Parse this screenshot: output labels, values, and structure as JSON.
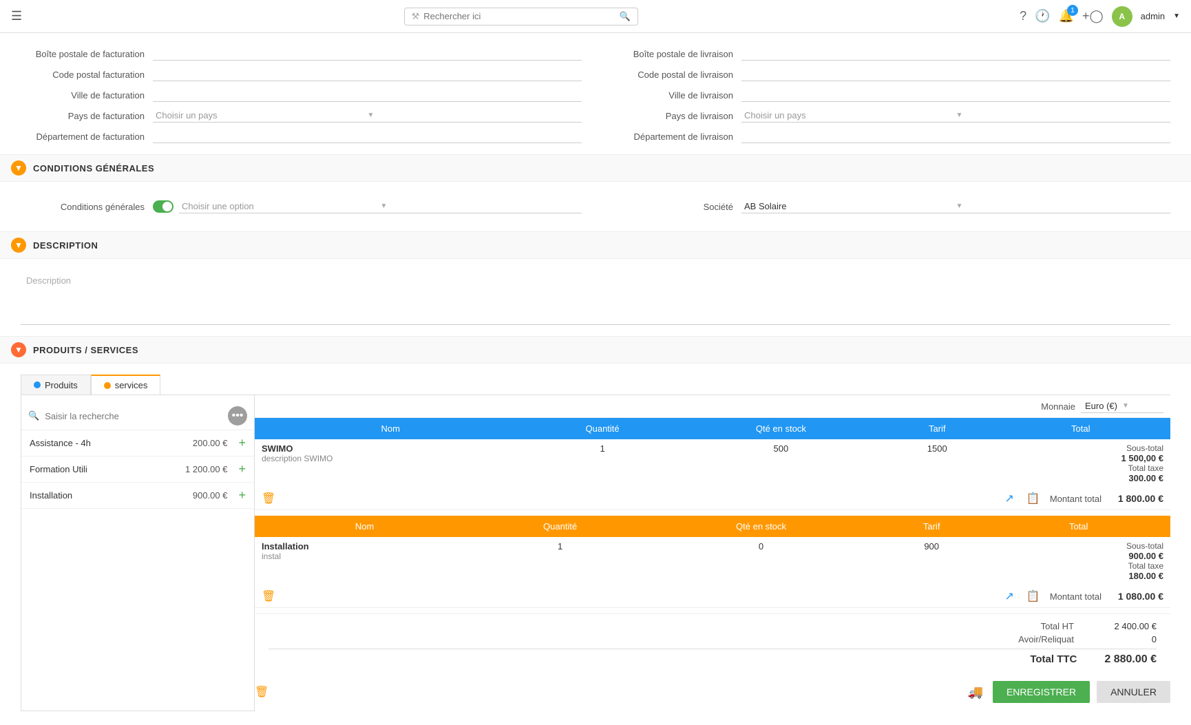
{
  "topbar": {
    "search_placeholder": "Rechercher ici",
    "notification_count": "1",
    "user_label": "admin",
    "user_initial": "A"
  },
  "form": {
    "billing": {
      "boite_postale_label": "Boîte postale de facturation",
      "code_postal_label": "Code postal facturation",
      "ville_label": "Ville de facturation",
      "pays_label": "Pays de facturation",
      "pays_placeholder": "Choisir un pays",
      "departement_label": "Département de facturation"
    },
    "delivery": {
      "boite_postale_label": "Boîte postale de livraison",
      "code_postal_label": "Code postal de livraison",
      "ville_label": "Ville de livraison",
      "pays_label": "Pays de livraison",
      "pays_placeholder": "Choisir un pays",
      "departement_label": "Département de livraison"
    }
  },
  "conditions_section": {
    "title": "CONDITIONS GÉNÉRALES",
    "conditions_generales_label": "Conditions générales",
    "conditions_placeholder": "Choisir une option",
    "societe_label": "Société",
    "societe_value": "AB Solaire"
  },
  "description_section": {
    "title": "DESCRIPTION",
    "placeholder": "Description"
  },
  "produits_section": {
    "title": "PRODUITS / SERVICES",
    "tabs": [
      {
        "label": "Produits",
        "color": "#2196f3",
        "active": false
      },
      {
        "label": "Services",
        "color": "#ff9800",
        "active": true
      }
    ],
    "currency_label": "Monnaie",
    "currency_value": "Euro (€)",
    "search_placeholder": "Saisir la recherche",
    "sidebar_items": [
      {
        "name": "Assistance - 4h",
        "price": "200.00 €"
      },
      {
        "name": "Formation Utili",
        "price": "1 200.00 €"
      },
      {
        "name": "Installation",
        "price": "900.00 €"
      }
    ],
    "table_headers": [
      "Nom",
      "Quantité",
      "Qté en stock",
      "Tarif",
      "Total"
    ],
    "blue_table": {
      "product_name": "SWIMO",
      "description": "description SWIMO",
      "quantite": "1",
      "qte_stock": "500",
      "tarif": "1500",
      "sous_total_label": "Sous-total",
      "sous_total_value": "1 500,00 €",
      "total_taxe_label": "Total taxe",
      "total_taxe_value": "300.00 €",
      "montant_total_label": "Montant total",
      "montant_total_value": "1 800.00 €"
    },
    "orange_table": {
      "product_name": "Installation",
      "description": "instal",
      "quantite": "1",
      "qte_stock": "0",
      "tarif": "900",
      "sous_total_label": "Sous-total",
      "sous_total_value": "900.00 €",
      "total_taxe_label": "Total taxe",
      "total_taxe_value": "180.00 €",
      "montant_total_label": "Montant total",
      "montant_total_value": "1 080.00 €"
    },
    "total_ht_label": "Total HT",
    "total_ht_value": "2 400.00 €",
    "avoir_label": "Avoir/Reliquat",
    "avoir_value": "0",
    "total_ttc_label": "Total TTC",
    "total_ttc_value": "2 880.00 €",
    "btn_enregistrer": "ENREGISTRER",
    "btn_annuler": "ANNULER"
  }
}
